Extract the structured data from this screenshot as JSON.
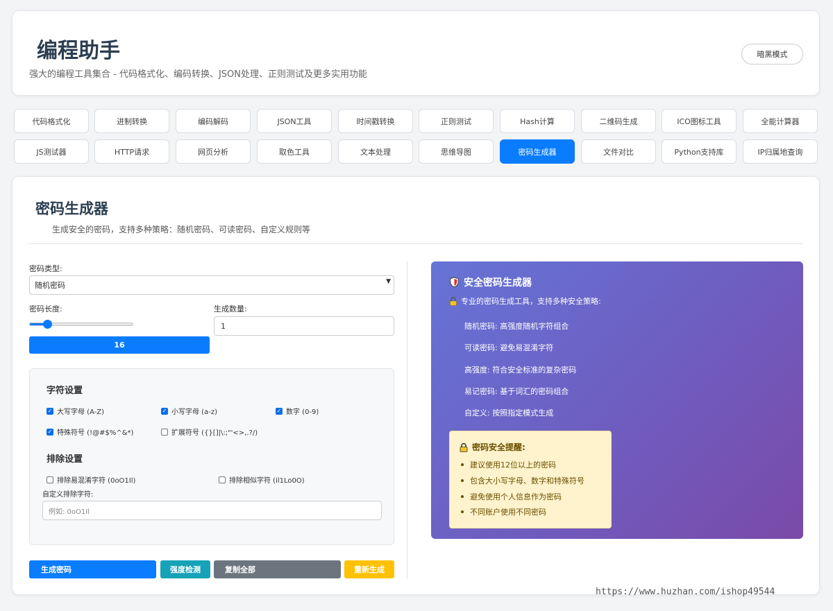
{
  "header": {
    "title": "编程助手",
    "subtitle": "强大的编程工具集合 - 代码格式化、编码转换、JSON处理、正则测试及更多实用功能",
    "dark_mode_label": "暗黑模式"
  },
  "nav": {
    "row1": [
      "代码格式化",
      "进制转换",
      "编码解码",
      "JSON工具",
      "时间戳转换",
      "正则测试",
      "Hash计算",
      "二维码生成",
      "ICO图标工具",
      "全能计算器"
    ],
    "row2": [
      "JS测试器",
      "HTTP请求",
      "网页分析",
      "取色工具",
      "文本处理",
      "思维导图",
      "密码生成器",
      "文件对比",
      "Python支持库",
      "IP归属地查询"
    ],
    "active": "密码生成器"
  },
  "tool": {
    "title": "密码生成器",
    "description": "生成安全的密码，支持多种策略：随机密码、可读密码、自定义规则等"
  },
  "form": {
    "type_label": "密码类型:",
    "type_value": "随机密码",
    "length_label": "密码长度:",
    "length_value": "16",
    "length_fraction": 0.17,
    "count_label": "生成数量:",
    "count_value": "1",
    "char_section": "字符设置",
    "checkboxes": {
      "upper": {
        "label": "大写字母 (A-Z)",
        "checked": true
      },
      "lower": {
        "label": "小写字母 (a-z)",
        "checked": true
      },
      "digits": {
        "label": "数字 (0-9)",
        "checked": true
      },
      "special": {
        "label": "特殊符号 (!@#$%^&*)",
        "checked": true
      },
      "extended": {
        "label": "扩展符号 ({}[]|\\:;\"'<>,.?/)",
        "checked": false
      }
    },
    "exclude_section": "排除设置",
    "exclude_ambiguous": {
      "label": "排除易混淆字符 (0oO1Il)",
      "checked": false
    },
    "exclude_similar": {
      "label": "排除相似字符 (il1Lo0O)",
      "checked": false
    },
    "custom_exclude_label": "自定义排除字符:",
    "custom_exclude_placeholder": "例如: 0oO1Il"
  },
  "actions": {
    "generate": "生成密码",
    "strength": "强度检测",
    "copy_all": "复制全部",
    "regenerate": "重新生成"
  },
  "info": {
    "title": "安全密码生成器",
    "intro": "专业的密码生成工具，支持多种安全策略:",
    "items": [
      "随机密码: 高强度随机字符组合",
      "可读密码: 避免易混淆字符",
      "高强度: 符合安全标准的复杂密码",
      "易记密码: 基于词汇的密码组合",
      "自定义: 按照指定模式生成"
    ],
    "tip_title": "密码安全提醒:",
    "tips": [
      "建议使用12位以上的密码",
      "包含大小写字母、数字和特殊符号",
      "避免使用个人信息作为密码",
      "不同账户使用不同密码"
    ]
  },
  "colors": {
    "primary": "#0a7cff",
    "info_strength": "#17a2b8",
    "secondary": "#6c757d",
    "warning": "#ffc107",
    "gradient_start": "#6574d6",
    "gradient_end": "#7a4aa8"
  },
  "icons": {
    "info_title": "shield-icon",
    "intro": "lock-icon",
    "tip": "lock-icon"
  },
  "watermark": "https://www.huzhan.com/ishop49544"
}
